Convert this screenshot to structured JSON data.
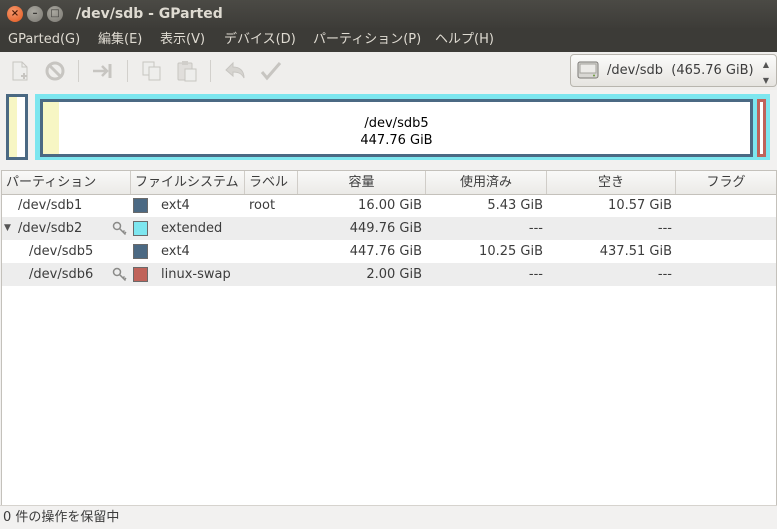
{
  "window": {
    "title": "/dev/sdb - GParted"
  },
  "menu": [
    {
      "label": "GParted(G)"
    },
    {
      "label": "編集(E)"
    },
    {
      "label": "表示(V)"
    },
    {
      "label": "デバイス(D)"
    },
    {
      "label": "パーティション(P)"
    },
    {
      "label": "ヘルプ(H)"
    }
  ],
  "toolbar": {
    "icons": [
      "new-partition-icon",
      "delete-icon",
      "resize-move-icon",
      "copy-icon",
      "paste-icon",
      "undo-icon",
      "apply-icon"
    ]
  },
  "device": {
    "label": "/dev/sdb  (465.76 GiB)"
  },
  "diskmap": {
    "selected_name": "/dev/sdb5",
    "selected_size": "447.76 GiB"
  },
  "table": {
    "headers": [
      "パーティション",
      "ファイルシステム",
      "ラベル",
      "容量",
      "使用済み",
      "空き",
      "フラグ"
    ],
    "rows": [
      {
        "partition": "/dev/sdb1",
        "fs": "ext4",
        "fs_color": "#4b6983",
        "label": "root",
        "size": "16.00 GiB",
        "used": "5.43 GiB",
        "free": "10.57 GiB",
        "flags": "",
        "mounted": false,
        "expander": false
      },
      {
        "partition": "/dev/sdb2",
        "fs": "extended",
        "fs_color": "#7de6ef",
        "label": "",
        "size": "449.76 GiB",
        "used": "---",
        "free": "---",
        "flags": "",
        "mounted": true,
        "expander": true
      },
      {
        "partition": "/dev/sdb5",
        "fs": "ext4",
        "fs_color": "#4b6983",
        "label": "",
        "size": "447.76 GiB",
        "used": "10.25 GiB",
        "free": "437.51 GiB",
        "flags": "",
        "mounted": false,
        "expander": false
      },
      {
        "partition": "/dev/sdb6",
        "fs": "linux-swap",
        "fs_color": "#c0635a",
        "label": "",
        "size": "2.00 GiB",
        "used": "---",
        "free": "---",
        "flags": "",
        "mounted": true,
        "expander": false
      }
    ]
  },
  "status": {
    "text": "0 件の操作を保留中"
  },
  "colors": {
    "ext4": "#4b6983",
    "extended": "#7de6ef",
    "swap": "#c0635a",
    "used": "#f7f6c4"
  }
}
